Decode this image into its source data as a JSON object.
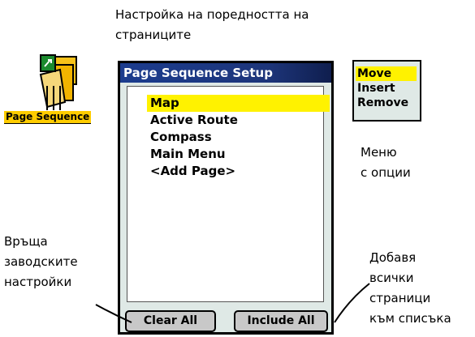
{
  "annotations": {
    "title_note": "Настройка на поредността на\nстраниците",
    "menu_note": "Меню\nс опции",
    "reset_note": "Връща\nзаводските\nнастройки",
    "include_note": "Добавя\nвсички\nстраници\nкъм списъка"
  },
  "app_icon": {
    "icon": "page-sequence-icon",
    "label": "Page Sequence"
  },
  "dialog": {
    "title": "Page Sequence Setup",
    "items": [
      {
        "label": "Map",
        "selected": true
      },
      {
        "label": "Active Route",
        "selected": false
      },
      {
        "label": "Compass",
        "selected": false
      },
      {
        "label": "Main Menu",
        "selected": false
      },
      {
        "label": "<Add Page>",
        "selected": false
      }
    ],
    "buttons": {
      "clear_all": "Clear All",
      "include_all": "Include All"
    }
  },
  "options_menu": {
    "items": [
      {
        "label": "Move",
        "selected": true
      },
      {
        "label": "Insert",
        "selected": false
      },
      {
        "label": "Remove",
        "selected": false
      }
    ]
  },
  "colors": {
    "selection": "#fff200",
    "title_bar": "#1d357a",
    "dialog_bg": "#dfe9e6",
    "icon_label_bg": "#ffcc00"
  }
}
